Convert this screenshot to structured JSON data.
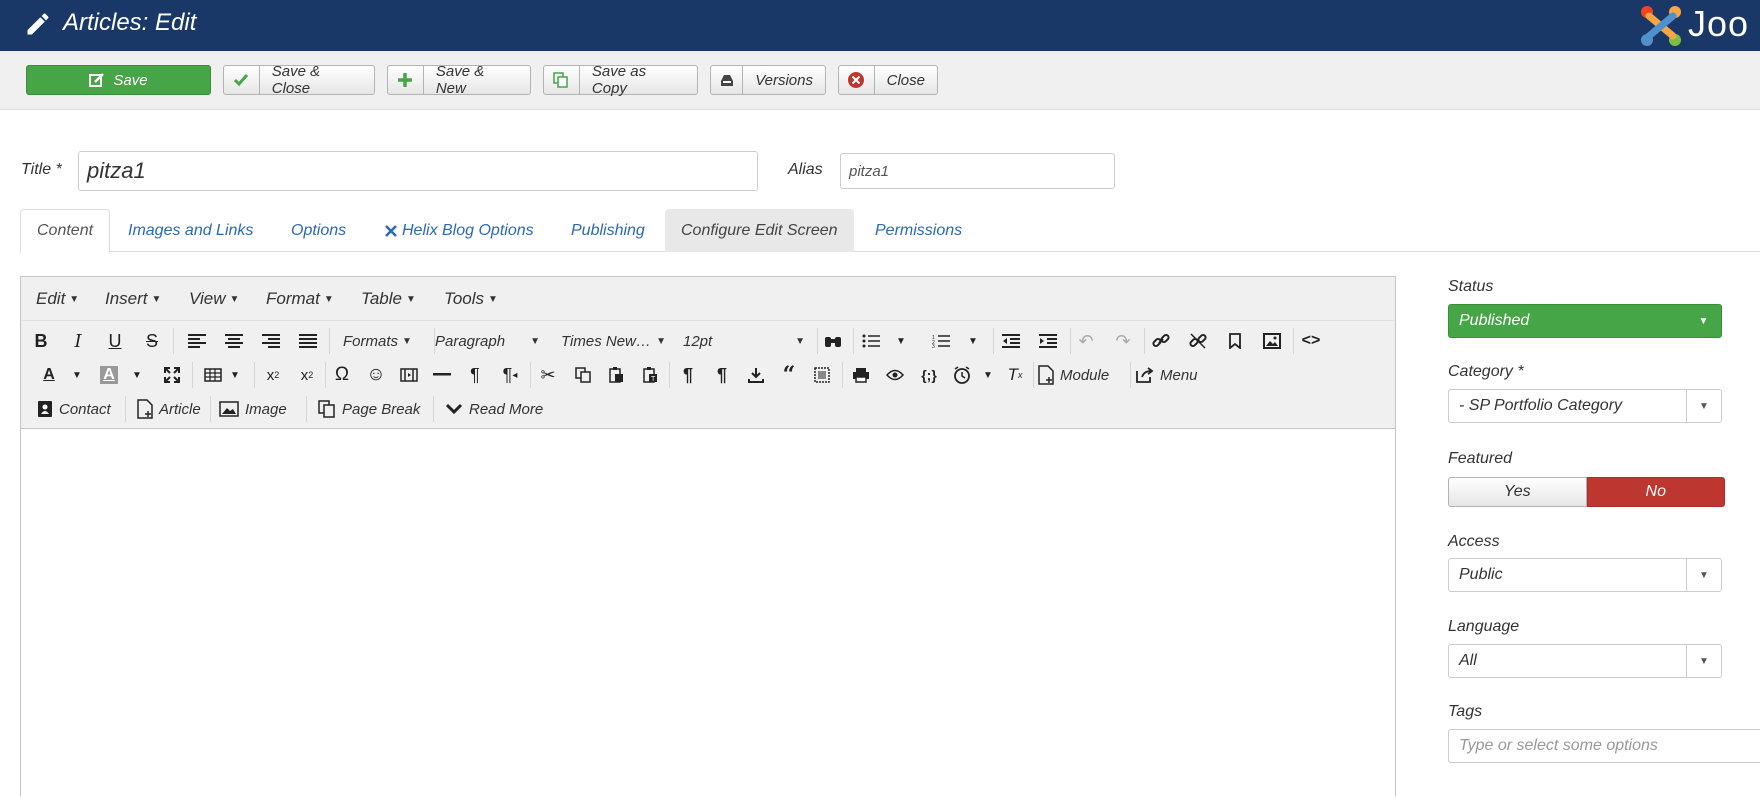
{
  "header": {
    "title": "Articles: Edit",
    "logo_text": "Joo"
  },
  "toolbar": {
    "save": "Save",
    "save_close": "Save & Close",
    "save_new": "Save & New",
    "save_copy": "Save as Copy",
    "versions": "Versions",
    "close": "Close"
  },
  "form": {
    "title_label": "Title *",
    "title_value": "pitza1",
    "alias_label": "Alias",
    "alias_value": "pitza1"
  },
  "tabs": [
    "Content",
    "Images and Links",
    "Options",
    "Helix Blog Options",
    "Publishing",
    "Configure Edit Screen",
    "Permissions"
  ],
  "editor": {
    "menus": [
      "Edit",
      "Insert",
      "View",
      "Format",
      "Table",
      "Tools"
    ],
    "formats": "Formats",
    "paragraph": "Paragraph",
    "font": "Times New…",
    "size": "12pt",
    "module": "Module",
    "menu": "Menu",
    "insert_buttons": [
      "Contact",
      "Article",
      "Image",
      "Page Break",
      "Read More"
    ]
  },
  "sidebar": {
    "status_label": "Status",
    "status_value": "Published",
    "category_label": "Category *",
    "category_value": "- SP Portfolio Category",
    "featured_label": "Featured",
    "featured_yes": "Yes",
    "featured_no": "No",
    "access_label": "Access",
    "access_value": "Public",
    "language_label": "Language",
    "language_value": "All",
    "tags_label": "Tags",
    "tags_placeholder": "Type or select some options"
  },
  "colors": {
    "header_bg": "#1a3867",
    "save_green": "#46a546",
    "no_red": "#bd362f",
    "link_blue": "#2a69b8"
  }
}
